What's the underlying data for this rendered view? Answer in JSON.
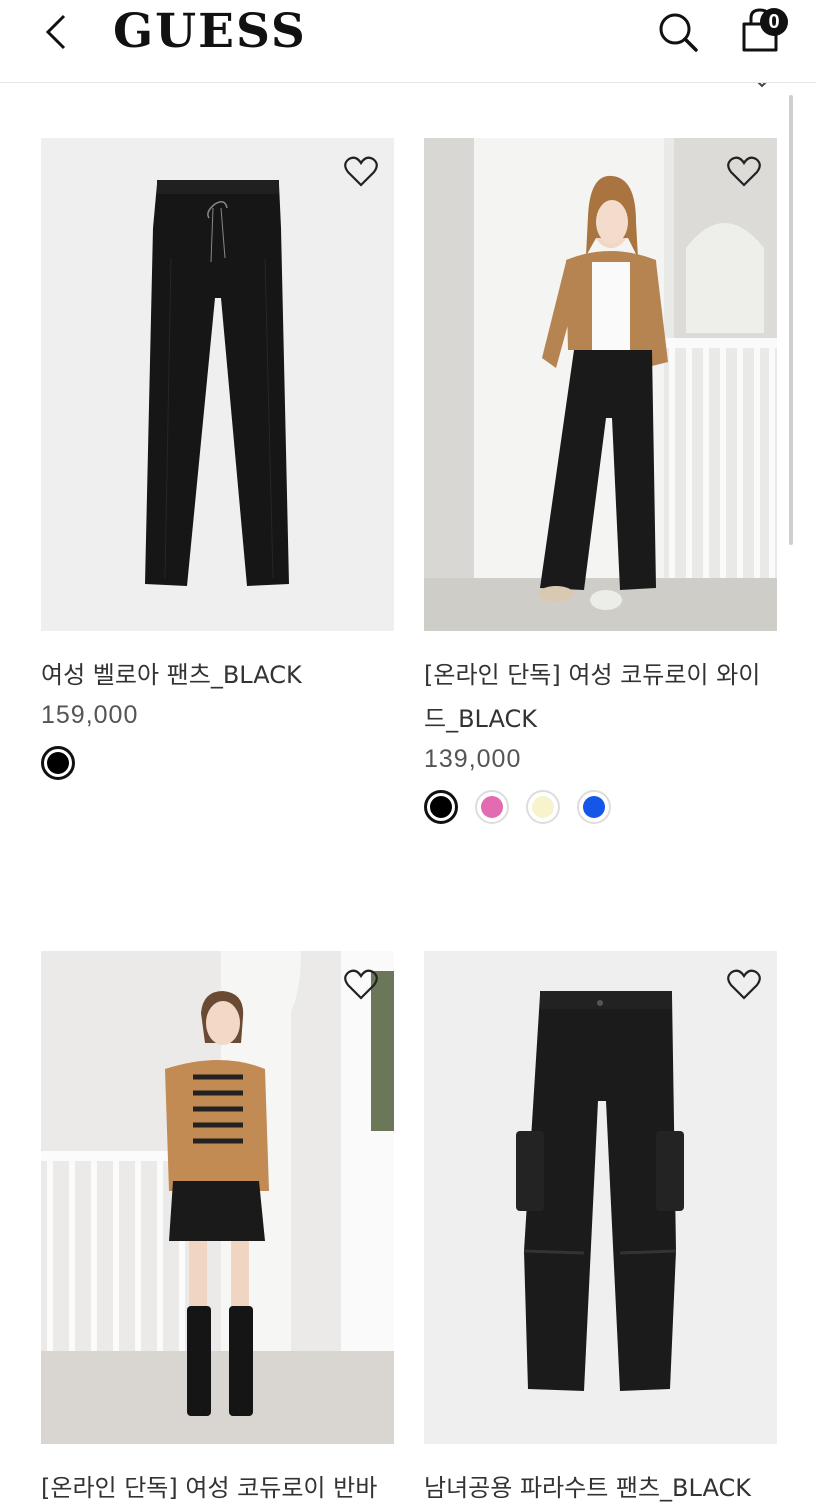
{
  "header": {
    "logo_text": "GUESS",
    "cart_count": "0",
    "icons": [
      "chevron-left-icon",
      "search-icon",
      "shopping-bag-icon"
    ]
  },
  "products": [
    {
      "name": "여성 벨로아 팬츠_BLACK",
      "price": "159,000",
      "image": "black velour wide pants product shot",
      "swatches": [
        {
          "color": "#000000",
          "selected": true
        }
      ]
    },
    {
      "name": "[온라인 단독] 여성 코듀로이 와이드_BLACK",
      "price": "139,000",
      "image": "model wearing tan cable cardigan and black corduroy wide pants",
      "swatches": [
        {
          "color": "#000000",
          "selected": true
        },
        {
          "color": "#e26bb2",
          "selected": false
        },
        {
          "color": "#f6f3cd",
          "selected": false
        },
        {
          "color": "#1456e8",
          "selected": false
        }
      ]
    },
    {
      "name": "[온라인 단독] 여성 코듀로이 반바",
      "image": "model wearing tan cardigan, striped top, black mini skirt and boots"
    },
    {
      "name": "남녀공용 파라수트 팬츠_BLACK",
      "image": "black parachute cargo pants product shot"
    }
  ]
}
